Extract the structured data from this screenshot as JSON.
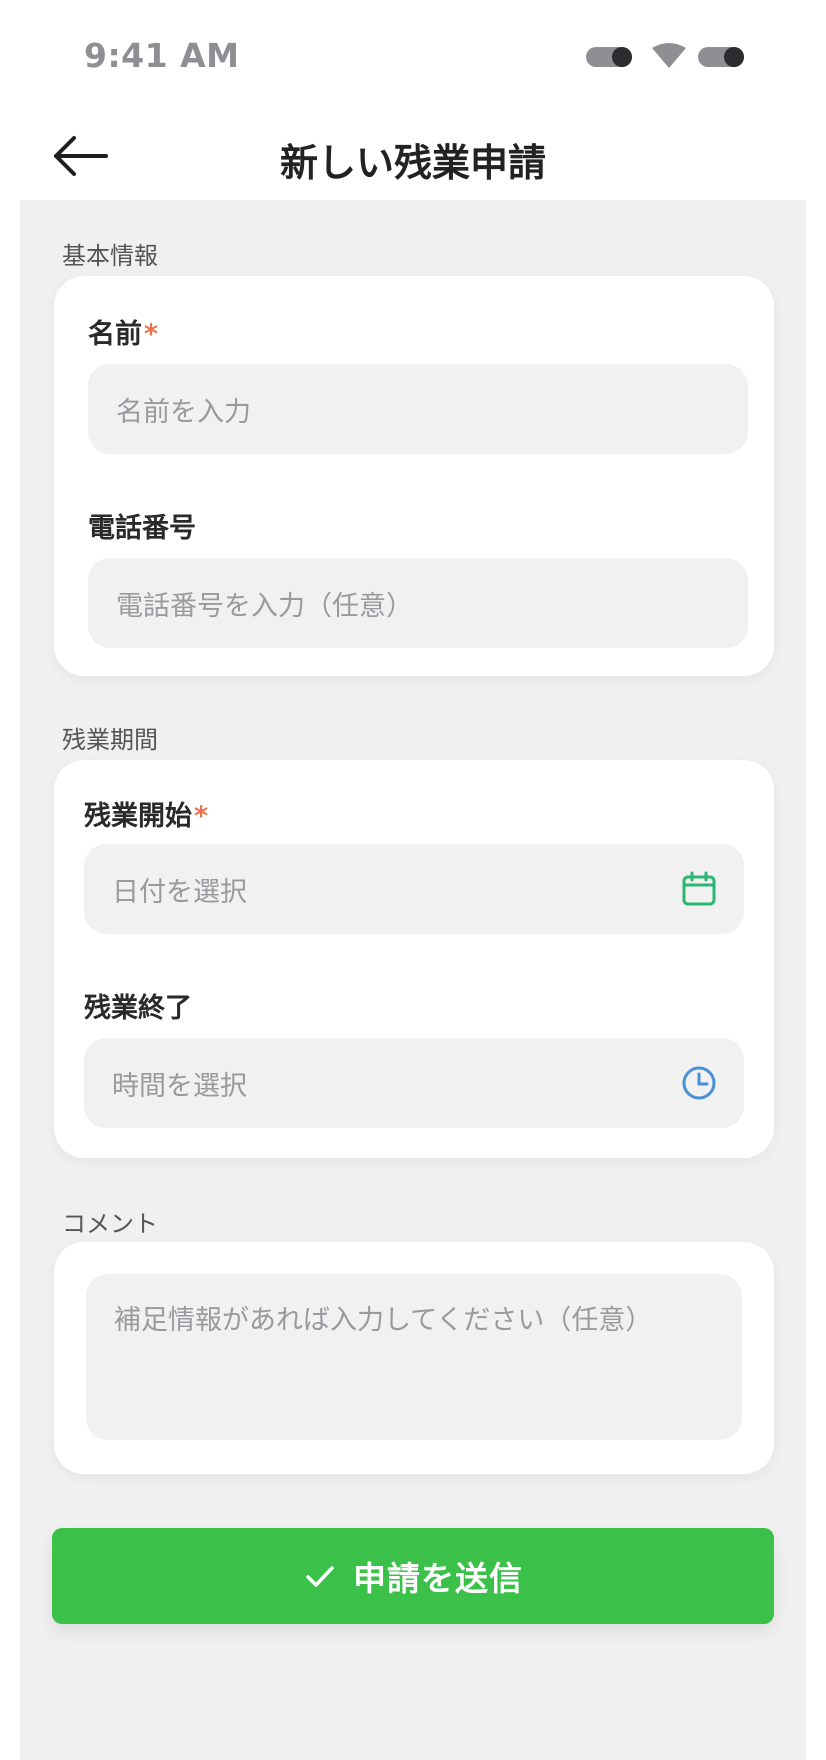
{
  "status_bar": {
    "time": "9:41 AM"
  },
  "header": {
    "title": "新しい残業申請"
  },
  "basic_info": {
    "section_label": "基本情報",
    "name": {
      "label": "名前",
      "required_mark": "*",
      "placeholder": "名前を入力"
    },
    "phone": {
      "label": "電話番号",
      "placeholder": "電話番号を入力（任意）"
    }
  },
  "overtime_period": {
    "section_label": "残業期間",
    "start": {
      "label": "残業開始",
      "required_mark": "*",
      "placeholder": "日付を選択",
      "icon": "calendar-icon"
    },
    "end": {
      "label": "残業終了",
      "placeholder": "時間を選択",
      "icon": "clock-icon"
    }
  },
  "comment": {
    "section_label": "コメント",
    "placeholder": "補足情報があれば入力してください（任意）"
  },
  "submit": {
    "label": "申請を送信",
    "icon": "check-icon"
  },
  "colors": {
    "accent_green": "#3bc14a",
    "calendar_icon": "#2bb673",
    "clock_icon": "#4a90d9",
    "required": "#e8734a"
  }
}
